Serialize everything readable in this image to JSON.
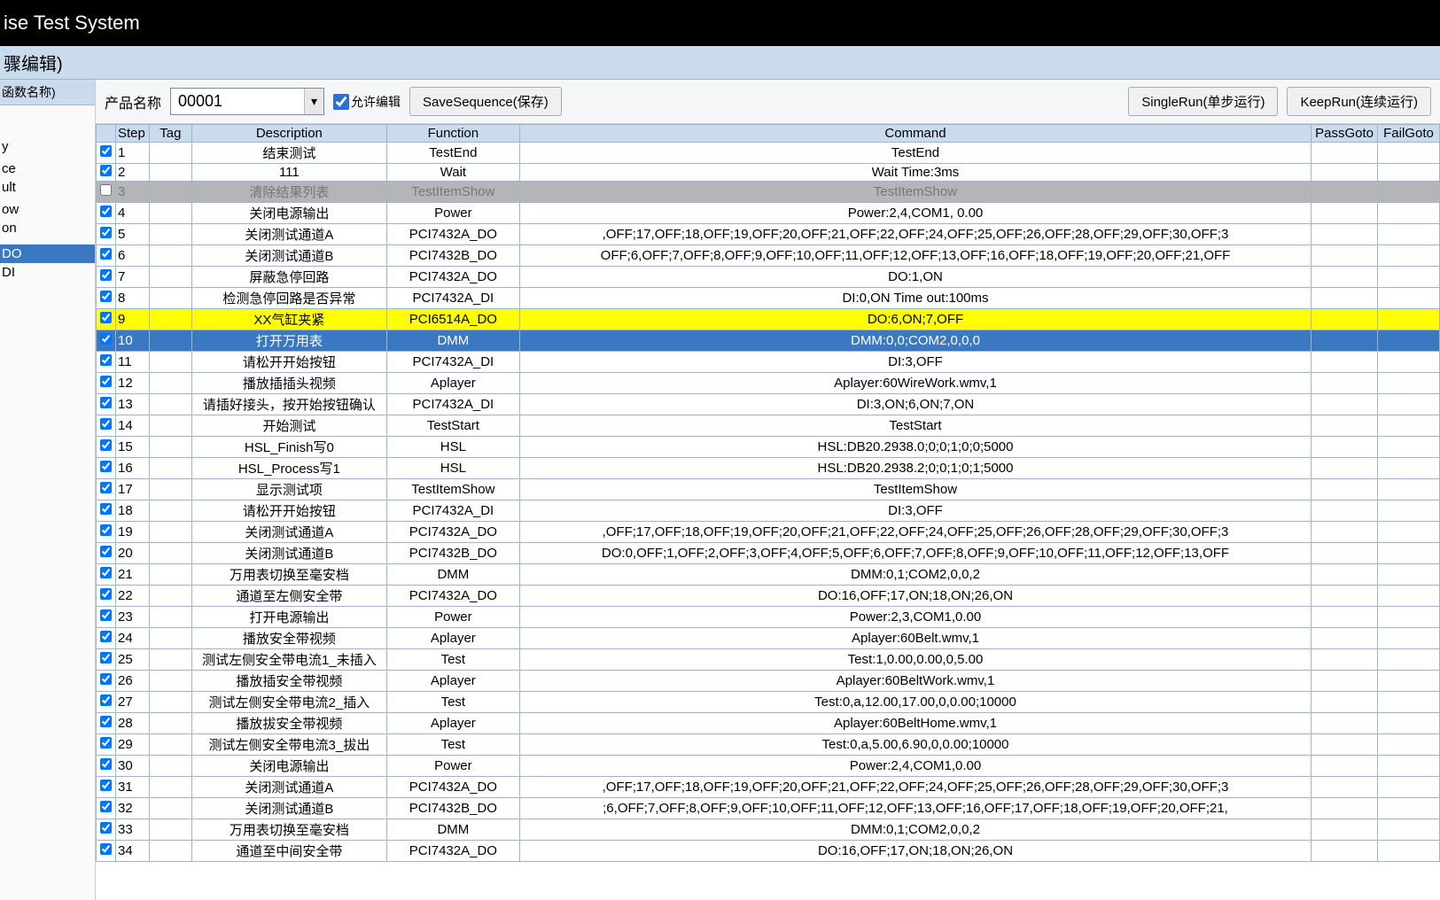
{
  "title": "ise Test System",
  "subtitle": "骤编辑)",
  "sidebar": {
    "header": "函数名称)",
    "items": [
      {
        "label": "",
        "sel": false
      },
      {
        "label": "",
        "sel": false
      },
      {
        "label": "",
        "sel": false
      },
      {
        "label": "",
        "sel": false
      },
      {
        "label": "",
        "sel": false
      },
      {
        "label": "",
        "sel": false
      },
      {
        "label": "",
        "sel": false
      },
      {
        "label": "",
        "sel": false
      },
      {
        "label": "",
        "sel": false
      },
      {
        "label": "y",
        "sel": false
      },
      {
        "label": "",
        "sel": false
      },
      {
        "label": "ce",
        "sel": false
      },
      {
        "label": "ult",
        "sel": false
      },
      {
        "label": "",
        "sel": false
      },
      {
        "label": "ow",
        "sel": false
      },
      {
        "label": "on",
        "sel": false
      },
      {
        "label": "",
        "sel": false
      },
      {
        "label": "",
        "sel": false
      },
      {
        "label": "DO",
        "sel": true
      },
      {
        "label": "DI",
        "sel": false
      }
    ]
  },
  "toolbar": {
    "product_label": "产品名称",
    "product_value": "00001",
    "allow_edit_label": "允许编辑",
    "save_label": "SaveSequence(保存)",
    "single_run_label": "SingleRun(单步运行)",
    "keep_run_label": "KeepRun(连续运行)"
  },
  "columns": [
    "Step",
    "Tag",
    "Description",
    "Function",
    "Command",
    "PassGoto",
    "FailGoto"
  ],
  "rows": [
    {
      "chk": true,
      "step": "1",
      "tag": "",
      "desc": "结束测试",
      "func": "TestEnd",
      "cmd": "TestEnd"
    },
    {
      "chk": true,
      "step": "2",
      "tag": "",
      "desc": "111",
      "func": "Wait",
      "cmd": "Wait Time:3ms"
    },
    {
      "chk": false,
      "step": "3",
      "tag": "",
      "desc": "清除结果列表",
      "func": "TestItemShow",
      "cmd": "TestItemShow",
      "state": "disabled"
    },
    {
      "chk": true,
      "step": "4",
      "tag": "",
      "desc": "关闭电源输出",
      "func": "Power",
      "cmd": "Power:2,4,COM1, 0.00"
    },
    {
      "chk": true,
      "step": "5",
      "tag": "",
      "desc": "关闭测试通道A",
      "func": "PCI7432A_DO",
      "cmd": ",OFF;17,OFF;18,OFF;19,OFF;20,OFF;21,OFF;22,OFF;24,OFF;25,OFF;26,OFF;28,OFF;29,OFF;30,OFF;3"
    },
    {
      "chk": true,
      "step": "6",
      "tag": "",
      "desc": "关闭测试通道B",
      "func": "PCI7432B_DO",
      "cmd": "OFF;6,OFF;7,OFF;8,OFF;9,OFF;10,OFF;11,OFF;12,OFF;13,OFF;16,OFF;18,OFF;19,OFF;20,OFF;21,OFF"
    },
    {
      "chk": true,
      "step": "7",
      "tag": "",
      "desc": "屏蔽急停回路",
      "func": "PCI7432A_DO",
      "cmd": "DO:1,ON"
    },
    {
      "chk": true,
      "step": "8",
      "tag": "",
      "desc": "检测急停回路是否异常",
      "func": "PCI7432A_DI",
      "cmd": "DI:0,ON Time out:100ms"
    },
    {
      "chk": true,
      "step": "9",
      "tag": "",
      "desc": "XX气缸夹紧",
      "func": "PCI6514A_DO",
      "cmd": "DO:6,ON;7,OFF",
      "state": "highlight"
    },
    {
      "chk": true,
      "step": "10",
      "tag": "",
      "desc": "打开万用表",
      "func": "DMM",
      "cmd": "DMM:0,0;COM2,0,0,0",
      "state": "selected"
    },
    {
      "chk": true,
      "step": "11",
      "tag": "",
      "desc": "请松开开始按钮",
      "func": "PCI7432A_DI",
      "cmd": "DI:3,OFF"
    },
    {
      "chk": true,
      "step": "12",
      "tag": "",
      "desc": "播放插插头视频",
      "func": "Aplayer",
      "cmd": "Aplayer:60WireWork.wmv,1"
    },
    {
      "chk": true,
      "step": "13",
      "tag": "",
      "desc": "请插好接头，按开始按钮确认",
      "func": "PCI7432A_DI",
      "cmd": "DI:3,ON;6,ON;7,ON"
    },
    {
      "chk": true,
      "step": "14",
      "tag": "",
      "desc": "开始测试",
      "func": "TestStart",
      "cmd": "TestStart"
    },
    {
      "chk": true,
      "step": "15",
      "tag": "",
      "desc": "HSL_Finish写0",
      "func": "HSL",
      "cmd": "HSL:DB20.2938.0;0;0;1;0;0;5000"
    },
    {
      "chk": true,
      "step": "16",
      "tag": "",
      "desc": "HSL_Process写1",
      "func": "HSL",
      "cmd": "HSL:DB20.2938.2;0;0;1;0;1;5000"
    },
    {
      "chk": true,
      "step": "17",
      "tag": "",
      "desc": "显示测试项",
      "func": "TestItemShow",
      "cmd": "TestItemShow"
    },
    {
      "chk": true,
      "step": "18",
      "tag": "",
      "desc": "请松开开始按钮",
      "func": "PCI7432A_DI",
      "cmd": "DI:3,OFF"
    },
    {
      "chk": true,
      "step": "19",
      "tag": "",
      "desc": "关闭测试通道A",
      "func": "PCI7432A_DO",
      "cmd": ",OFF;17,OFF;18,OFF;19,OFF;20,OFF;21,OFF;22,OFF;24,OFF;25,OFF;26,OFF;28,OFF;29,OFF;30,OFF;3"
    },
    {
      "chk": true,
      "step": "20",
      "tag": "",
      "desc": "关闭测试通道B",
      "func": "PCI7432B_DO",
      "cmd": "DO:0,OFF;1,OFF;2,OFF;3,OFF;4,OFF;5,OFF;6,OFF;7,OFF;8,OFF;9,OFF;10,OFF;11,OFF;12,OFF;13,OFF"
    },
    {
      "chk": true,
      "step": "21",
      "tag": "",
      "desc": "万用表切换至毫安档",
      "func": "DMM",
      "cmd": "DMM:0,1;COM2,0,0,2"
    },
    {
      "chk": true,
      "step": "22",
      "tag": "",
      "desc": "通道至左侧安全带",
      "func": "PCI7432A_DO",
      "cmd": "DO:16,OFF;17,ON;18,ON;26,ON"
    },
    {
      "chk": true,
      "step": "23",
      "tag": "",
      "desc": "打开电源输出",
      "func": "Power",
      "cmd": "Power:2,3,COM1,0.00"
    },
    {
      "chk": true,
      "step": "24",
      "tag": "",
      "desc": "播放安全带视频",
      "func": "Aplayer",
      "cmd": "Aplayer:60Belt.wmv,1"
    },
    {
      "chk": true,
      "step": "25",
      "tag": "",
      "desc": "测试左侧安全带电流1_未插入",
      "func": "Test",
      "cmd": "Test:1,0.00,0.00,0,5.00"
    },
    {
      "chk": true,
      "step": "26",
      "tag": "",
      "desc": "播放插安全带视频",
      "func": "Aplayer",
      "cmd": "Aplayer:60BeltWork.wmv,1"
    },
    {
      "chk": true,
      "step": "27",
      "tag": "",
      "desc": "测试左侧安全带电流2_插入",
      "func": "Test",
      "cmd": "Test:0,a,12.00,17.00,0,0.00;10000"
    },
    {
      "chk": true,
      "step": "28",
      "tag": "",
      "desc": "播放拔安全带视频",
      "func": "Aplayer",
      "cmd": "Aplayer:60BeltHome.wmv,1"
    },
    {
      "chk": true,
      "step": "29",
      "tag": "",
      "desc": "测试左侧安全带电流3_拔出",
      "func": "Test",
      "cmd": "Test:0,a,5.00,6.90,0,0.00;10000"
    },
    {
      "chk": true,
      "step": "30",
      "tag": "",
      "desc": "关闭电源输出",
      "func": "Power",
      "cmd": "Power:2,4,COM1,0.00"
    },
    {
      "chk": true,
      "step": "31",
      "tag": "",
      "desc": "关闭测试通道A",
      "func": "PCI7432A_DO",
      "cmd": ",OFF;17,OFF;18,OFF;19,OFF;20,OFF;21,OFF;22,OFF;24,OFF;25,OFF;26,OFF;28,OFF;29,OFF;30,OFF;3"
    },
    {
      "chk": true,
      "step": "32",
      "tag": "",
      "desc": "关闭测试通道B",
      "func": "PCI7432B_DO",
      "cmd": ";6,OFF;7,OFF;8,OFF;9,OFF;10,OFF;11,OFF;12,OFF;13,OFF;16,OFF;17,OFF;18,OFF;19,OFF;20,OFF;21,"
    },
    {
      "chk": true,
      "step": "33",
      "tag": "",
      "desc": "万用表切换至毫安档",
      "func": "DMM",
      "cmd": "DMM:0,1;COM2,0,0,2"
    },
    {
      "chk": true,
      "step": "34",
      "tag": "",
      "desc": "通道至中间安全带",
      "func": "PCI7432A_DO",
      "cmd": "DO:16,OFF;17,ON;18,ON;26,ON"
    }
  ]
}
